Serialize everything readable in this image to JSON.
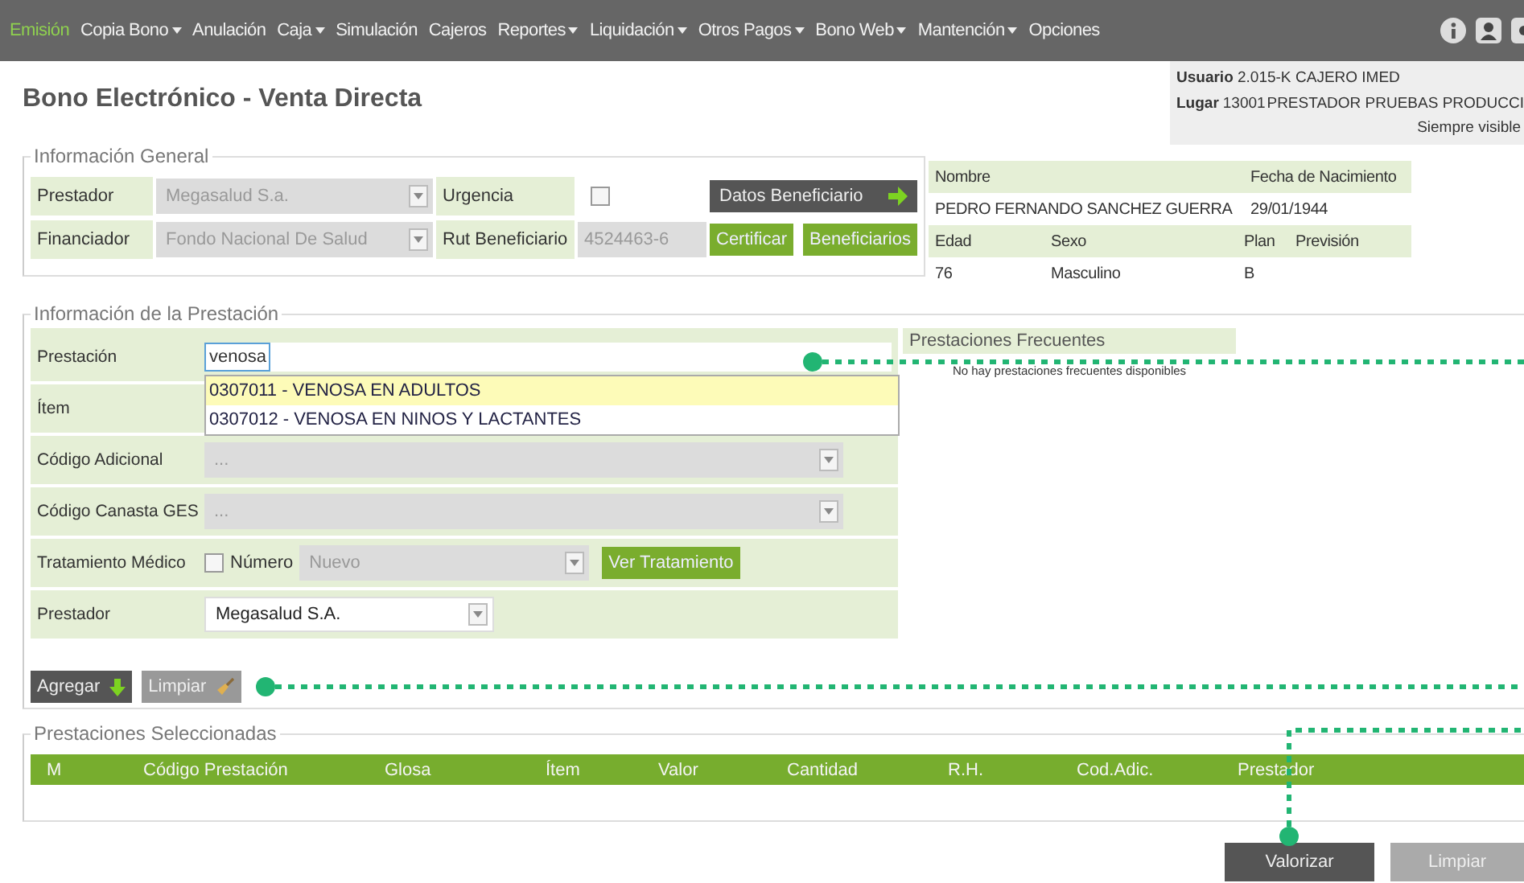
{
  "menu": [
    {
      "label": "Emisión",
      "selected": true,
      "dropdown": false
    },
    {
      "label": "Copia Bono",
      "selected": false,
      "dropdown": true
    },
    {
      "label": "Anulación",
      "selected": false,
      "dropdown": false
    },
    {
      "label": "Caja",
      "selected": false,
      "dropdown": true
    },
    {
      "label": "Simulación",
      "selected": false,
      "dropdown": false
    },
    {
      "label": "Cajeros",
      "selected": false,
      "dropdown": false
    },
    {
      "label": "Reportes",
      "selected": false,
      "dropdown": true
    },
    {
      "label": "Liquidación",
      "selected": false,
      "dropdown": true
    },
    {
      "label": "Otros Pagos",
      "selected": false,
      "dropdown": true
    },
    {
      "label": "Bono Web",
      "selected": false,
      "dropdown": true
    },
    {
      "label": "Mantención",
      "selected": false,
      "dropdown": true
    },
    {
      "label": "Opciones",
      "selected": false,
      "dropdown": false
    }
  ],
  "page_title": "Bono Electrónico - Venta Directa",
  "session": {
    "rows": [
      {
        "label": "Usuario",
        "code": "2.015-K",
        "value": "CAJERO IMED"
      },
      {
        "label": "Lugar",
        "code": "13001",
        "value": "PRESTADOR PRUEBAS PRODUCCI"
      }
    ],
    "note": "Siempre visible"
  },
  "general": {
    "legend": "Información General",
    "prestador": {
      "label": "Prestador",
      "value": "Megasalud S.a."
    },
    "urgencia": {
      "label": "Urgencia",
      "checked": false
    },
    "financiador": {
      "label": "Financiador",
      "value": "Fondo Nacional De Salud"
    },
    "rut": {
      "label": "Rut Beneficiario",
      "value": "4524463-6"
    },
    "buttons": {
      "datos": "Datos Beneficiario",
      "certificar": "Certificar",
      "beneficiarios": "Beneficiarios"
    }
  },
  "beneficiary": {
    "headers1": [
      "Nombre",
      "Fecha de Nacimiento"
    ],
    "values1": [
      "PEDRO FERNANDO SANCHEZ GUERRA",
      "29/01/1944"
    ],
    "headers2": [
      "Edad",
      "Sexo",
      "Plan",
      "Previsión"
    ],
    "values2": [
      "76",
      "Masculino",
      "B"
    ]
  },
  "prestacion": {
    "legend": "Información de la Prestación",
    "rows": [
      {
        "kind": "search",
        "label": "Prestación",
        "value": "venosa"
      },
      {
        "kind": "item",
        "label": "Ítem"
      },
      {
        "kind": "select",
        "label": "Código Adicional",
        "value": "...",
        "disabled": true
      },
      {
        "kind": "select",
        "label": "Código Canasta GES",
        "value": "...",
        "disabled": true
      },
      {
        "kind": "tratamiento",
        "label": "Tratamiento Médico",
        "checked": false,
        "number_label": "Número",
        "value": "Nuevo",
        "button": "Ver Tratamiento"
      },
      {
        "kind": "select",
        "label": "Prestador",
        "value": "Megasalud S.A.",
        "disabled": false
      }
    ],
    "suggestions": [
      {
        "text": "0307011 - VENOSA EN ADULTOS",
        "selected": true
      },
      {
        "text": "0307012 - VENOSA EN NINOS Y LACTANTES",
        "selected": false
      }
    ],
    "frecuentes": {
      "title": "Prestaciones Frecuentes",
      "empty": "No hay prestaciones frecuentes disponibles"
    },
    "agregar": "Agregar",
    "limpiar": "Limpiar"
  },
  "seleccionadas": {
    "legend": "Prestaciones Seleccionadas",
    "columns": [
      "M",
      "Código Prestación",
      "Glosa",
      "Ítem",
      "Valor",
      "Cantidad",
      "R.H.",
      "Cod.Adic.",
      "Prestador"
    ]
  },
  "footer_buttons": [
    {
      "label": "Valorizar",
      "kind": "primary"
    },
    {
      "label": "Limpiar",
      "kind": "secondary"
    }
  ]
}
